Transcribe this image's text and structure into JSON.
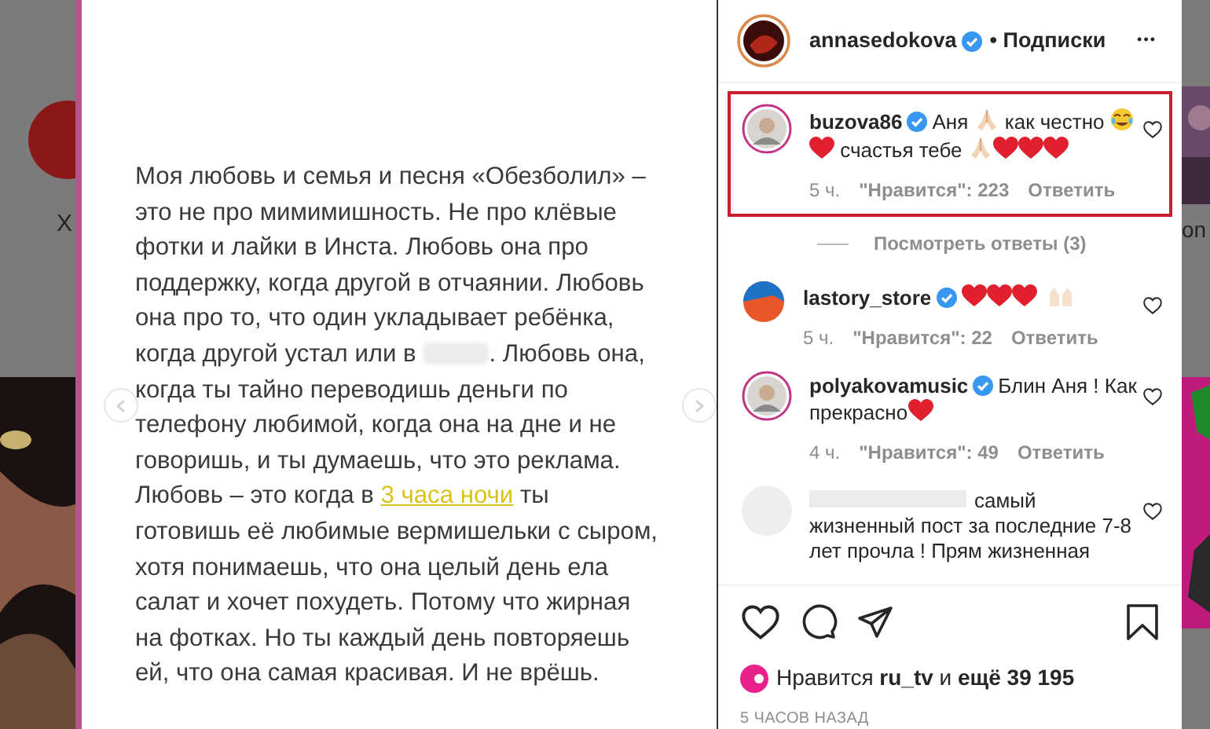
{
  "background": {
    "left_text": "Х",
    "right_text": "on"
  },
  "post": {
    "lines": [
      [
        {
          "kind": "text",
          "text": "Моя любовь и семья и песня «Обезболил» –"
        }
      ],
      [
        {
          "kind": "text",
          "text": "это не про мимимишность. Не про клёвые"
        }
      ],
      [
        {
          "kind": "text",
          "text": "фотки и лайки в Инста. Любовь она про"
        }
      ],
      [
        {
          "kind": "text",
          "text": "поддержку, когда другой в отчаянии. Любовь"
        }
      ],
      [
        {
          "kind": "text",
          "text": "она про то, что один укладывает ребёнка,"
        }
      ],
      [
        {
          "kind": "text",
          "text": "когда другой устал или в "
        },
        {
          "kind": "redacted"
        },
        {
          "kind": "text",
          "text": ". Любовь она,"
        }
      ],
      [
        {
          "kind": "text",
          "text": "когда ты тайно переводишь деньги по"
        }
      ],
      [
        {
          "kind": "text",
          "text": "телефону любимой, когда она на дне и не"
        }
      ],
      [
        {
          "kind": "text",
          "text": "говоришь, и ты думаешь, что это реклама."
        }
      ],
      [
        {
          "kind": "text",
          "text": "Любовь – это когда в "
        },
        {
          "kind": "link",
          "text": "3 часа ночи"
        },
        {
          "kind": "text",
          "text": " ты"
        }
      ],
      [
        {
          "kind": "text",
          "text": "готовишь её любимые вермишельки с сыром,"
        }
      ],
      [
        {
          "kind": "text",
          "text": "хотя понимаешь, что она целый день ела"
        }
      ],
      [
        {
          "kind": "text",
          "text": "салат и хочет похудеть. Потому что жирная"
        }
      ],
      [
        {
          "kind": "text",
          "text": "на фотках. Но ты каждый день повторяешь"
        }
      ],
      [
        {
          "kind": "text",
          "text": "ей, что она самая красивая. И не врёшь."
        }
      ]
    ]
  },
  "header": {
    "username": "annasedokova",
    "verified": true,
    "follow": "• Подписки",
    "more": "•••"
  },
  "comments": [
    {
      "username": "buzova86",
      "verified": true,
      "highlighted": true,
      "redacted_name": false,
      "parts": [
        {
          "kind": "text",
          "text": "Аня "
        },
        {
          "kind": "pray"
        },
        {
          "kind": "text",
          "text": " как честно "
        },
        {
          "kind": "tears"
        },
        {
          "kind": "heart"
        },
        {
          "kind": "text",
          "text": " счастья тебе "
        },
        {
          "kind": "pray"
        },
        {
          "kind": "heart"
        },
        {
          "kind": "heart"
        },
        {
          "kind": "heart"
        }
      ],
      "time": "5 ч.",
      "likes": "\"Нравится\": 223",
      "reply": "Ответить",
      "view_replies": "Посмотреть ответы (3)"
    },
    {
      "username": "lastory_store",
      "verified": true,
      "highlighted": false,
      "kind": "logo",
      "redacted_name": false,
      "parts": [
        {
          "kind": "heart"
        },
        {
          "kind": "heart"
        },
        {
          "kind": "heart"
        },
        {
          "kind": "hands"
        }
      ],
      "time": "5 ч.",
      "likes": "\"Нравится\": 22",
      "reply": "Ответить"
    },
    {
      "username": "polyakovamusic",
      "verified": true,
      "highlighted": false,
      "redacted_name": false,
      "parts": [
        {
          "kind": "text",
          "text": "Блин Аня ! Как прекрасно"
        },
        {
          "kind": "heart"
        }
      ],
      "time": "4 ч.",
      "likes": "\"Нравится\": 49",
      "reply": "Ответить"
    },
    {
      "verified": false,
      "highlighted": false,
      "kind": "blank",
      "redacted_name": true,
      "parts": [
        {
          "kind": "text",
          "text": "самый жизненный пост за последние 7-8 лет прочла ! Прям жизненная"
        }
      ]
    }
  ],
  "likes": {
    "text": "Нравится **ru_tv** и **ещё 39 195**",
    "time": "5 ЧАСОВ НАЗАД"
  }
}
